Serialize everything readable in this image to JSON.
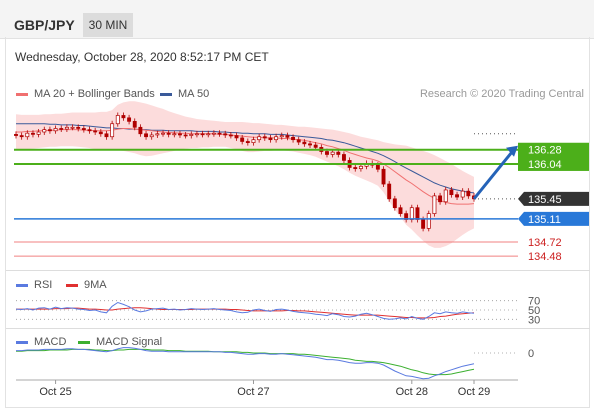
{
  "header": {
    "pair": "GBP/JPY",
    "timeframe": "30 MIN",
    "datetime": "Wednesday, October 28, 2020 8:52:17 PM CET"
  },
  "legend": {
    "ma20_label": "MA 20 + Bollinger Bands",
    "ma50_label": "MA 50",
    "credit": "Research © 2020 Trading Central",
    "rsi_label": "RSI",
    "rsi_ma_label": "9MA",
    "macd_label": "MACD",
    "macd_signal_label": "MACD Signal"
  },
  "colors": {
    "ma20": "#f07070",
    "ma50": "#3a5a9a",
    "bollinger_fill": "#fbd0d0",
    "resistance": "#4caf1a",
    "support": "#2878d8",
    "pivot_red": "#f08080",
    "price_badge": "#333333",
    "arrow": "#2563b8",
    "rsi": "#5a7ae0",
    "rsi_ma": "#e03030",
    "macd": "#5a7ae0",
    "macd_signal": "#3cb030"
  },
  "chart_data": [
    {
      "type": "line",
      "panel": "price",
      "x_ticks": [
        "Oct 25",
        "Oct 27",
        "Oct 28",
        "Oct 29"
      ],
      "last_price": 135.45,
      "levels": [
        {
          "value": 136.28,
          "label": "136.28",
          "kind": "resistance"
        },
        {
          "value": 136.04,
          "label": "136.04",
          "kind": "resistance"
        },
        {
          "value": 135.45,
          "label": "135.45",
          "kind": "last"
        },
        {
          "value": 135.11,
          "label": "135.11",
          "kind": "support"
        },
        {
          "value": 134.72,
          "label": "134.72",
          "kind": "pivot"
        },
        {
          "value": 134.48,
          "label": "134.48",
          "kind": "pivot"
        }
      ],
      "close": [
        136.52,
        136.5,
        136.56,
        136.54,
        136.58,
        136.62,
        136.6,
        136.64,
        136.63,
        136.66,
        136.66,
        136.64,
        136.62,
        136.6,
        136.58,
        136.55,
        136.5,
        136.72,
        136.86,
        136.82,
        136.76,
        136.66,
        136.55,
        136.5,
        136.53,
        136.55,
        136.56,
        136.54,
        136.55,
        136.53,
        136.52,
        136.54,
        136.55,
        136.54,
        136.55,
        136.56,
        136.55,
        136.53,
        136.52,
        136.48,
        136.42,
        136.4,
        136.45,
        136.5,
        136.48,
        136.45,
        136.5,
        136.52,
        136.49,
        136.45,
        136.41,
        136.38,
        136.36,
        136.32,
        136.25,
        136.2,
        136.24,
        136.2,
        136.1,
        135.98,
        135.96,
        136.0,
        136.05,
        136.02,
        135.95,
        135.7,
        135.45,
        135.3,
        135.2,
        135.1,
        135.3,
        135.1,
        134.95,
        135.2,
        135.5,
        135.4,
        135.6,
        135.52,
        135.48,
        135.58,
        135.5,
        135.45
      ],
      "ma20": [
        136.58,
        136.58,
        136.59,
        136.59,
        136.6,
        136.6,
        136.61,
        136.61,
        136.62,
        136.62,
        136.62,
        136.62,
        136.61,
        136.61,
        136.6,
        136.6,
        136.6,
        136.61,
        136.63,
        136.64,
        136.64,
        136.63,
        136.62,
        136.61,
        136.6,
        136.59,
        136.58,
        136.57,
        136.57,
        136.56,
        136.56,
        136.55,
        136.55,
        136.55,
        136.55,
        136.55,
        136.54,
        136.54,
        136.53,
        136.52,
        136.51,
        136.5,
        136.49,
        136.49,
        136.48,
        136.48,
        136.48,
        136.47,
        136.47,
        136.46,
        136.45,
        136.44,
        136.42,
        136.4,
        136.38,
        136.35,
        136.33,
        136.3,
        136.27,
        136.23,
        136.2,
        136.17,
        136.14,
        136.12,
        136.09,
        136.04,
        135.98,
        135.91,
        135.84,
        135.77,
        135.71,
        135.64,
        135.57,
        135.51,
        135.46,
        135.42,
        135.39,
        135.37,
        135.36,
        135.36,
        135.36,
        135.37
      ],
      "ma50": [
        136.72,
        136.72,
        136.72,
        136.72,
        136.72,
        136.72,
        136.71,
        136.71,
        136.7,
        136.7,
        136.7,
        136.69,
        136.69,
        136.68,
        136.67,
        136.66,
        136.65,
        136.65,
        136.64,
        136.64,
        136.63,
        136.63,
        136.62,
        136.62,
        136.61,
        136.61,
        136.61,
        136.6,
        136.6,
        136.6,
        136.6,
        136.6,
        136.59,
        136.59,
        136.59,
        136.59,
        136.58,
        136.58,
        136.57,
        136.57,
        136.56,
        136.56,
        136.55,
        136.55,
        136.55,
        136.54,
        136.54,
        136.54,
        136.53,
        136.52,
        136.51,
        136.5,
        136.49,
        136.48,
        136.47,
        136.45,
        136.44,
        136.42,
        136.4,
        136.37,
        136.34,
        136.31,
        136.28,
        136.25,
        136.22,
        136.18,
        136.13,
        136.08,
        136.02,
        135.97,
        135.92,
        135.87,
        135.82,
        135.77,
        135.72,
        135.68,
        135.65,
        135.62,
        135.6,
        135.58,
        135.56,
        135.55
      ],
      "bb_upper": [
        136.88,
        136.87,
        136.87,
        136.87,
        136.87,
        136.88,
        136.88,
        136.89,
        136.89,
        136.9,
        136.91,
        136.91,
        136.91,
        136.91,
        136.91,
        136.92,
        136.92,
        136.95,
        137.04,
        137.08,
        137.1,
        137.1,
        137.08,
        137.06,
        137.03,
        137.0,
        136.97,
        136.93,
        136.9,
        136.87,
        136.84,
        136.82,
        136.8,
        136.79,
        136.78,
        136.77,
        136.76,
        136.75,
        136.75,
        136.75,
        136.75,
        136.74,
        136.73,
        136.73,
        136.72,
        136.71,
        136.7,
        136.7,
        136.69,
        136.68,
        136.67,
        136.67,
        136.66,
        136.65,
        136.64,
        136.63,
        136.62,
        136.6,
        136.58,
        136.56,
        136.53,
        136.5,
        136.48,
        136.46,
        136.44,
        136.41,
        136.39,
        136.37,
        136.36,
        136.35,
        136.32,
        136.29,
        136.26,
        136.23,
        136.19,
        136.14,
        136.09,
        136.04,
        135.98,
        135.92,
        135.87,
        135.82
      ],
      "bb_lower": [
        136.28,
        136.28,
        136.29,
        136.3,
        136.31,
        136.32,
        136.33,
        136.33,
        136.34,
        136.34,
        136.34,
        136.33,
        136.32,
        136.31,
        136.29,
        136.28,
        136.27,
        136.27,
        136.27,
        136.26,
        136.24,
        136.22,
        136.19,
        136.17,
        136.18,
        136.2,
        136.22,
        136.24,
        136.26,
        136.28,
        136.3,
        136.31,
        136.31,
        136.32,
        136.32,
        136.33,
        136.33,
        136.33,
        136.31,
        136.29,
        136.26,
        136.24,
        136.24,
        136.25,
        136.26,
        136.26,
        136.27,
        136.27,
        136.26,
        136.25,
        136.23,
        136.21,
        136.19,
        136.16,
        136.12,
        136.08,
        136.04,
        136.0,
        135.95,
        135.89,
        135.84,
        135.8,
        135.76,
        135.72,
        135.67,
        135.56,
        135.41,
        135.27,
        135.14,
        135.01,
        134.93,
        134.83,
        134.74,
        134.66,
        134.62,
        134.62,
        134.65,
        134.7,
        134.77,
        134.84,
        134.9,
        134.95
      ],
      "forecast": {
        "from": 135.45,
        "to": 136.28
      }
    },
    {
      "type": "line",
      "panel": "rsi",
      "levels": [
        {
          "value": 70,
          "label": "70"
        },
        {
          "value": 50,
          "label": "50"
        },
        {
          "value": 30,
          "label": "30"
        }
      ],
      "series": [
        {
          "name": "RSI",
          "values": [
            52,
            51,
            53,
            50,
            54,
            55,
            52,
            56,
            53,
            55,
            54,
            52,
            51,
            49,
            50,
            46,
            44,
            58,
            66,
            62,
            57,
            50,
            46,
            48,
            52,
            53,
            54,
            51,
            52,
            50,
            51,
            53,
            52,
            51,
            52,
            53,
            51,
            50,
            49,
            46,
            44,
            45,
            50,
            52,
            49,
            47,
            51,
            52,
            50,
            47,
            45,
            44,
            43,
            41,
            40,
            38,
            42,
            40,
            36,
            35,
            37,
            41,
            43,
            40,
            36,
            32,
            30,
            31,
            33,
            31,
            36,
            32,
            30,
            36,
            44,
            42,
            46,
            44,
            43,
            46,
            44,
            43
          ]
        },
        {
          "name": "9MA",
          "values": [
            52,
            52,
            52,
            52,
            52,
            52,
            52,
            53,
            53,
            53,
            54,
            54,
            53,
            52,
            52,
            51,
            50,
            50,
            52,
            53,
            54,
            55,
            55,
            54,
            53,
            52,
            51,
            51,
            51,
            51,
            51,
            51,
            52,
            52,
            52,
            52,
            52,
            52,
            51,
            51,
            50,
            49,
            48,
            48,
            48,
            48,
            48,
            48,
            49,
            49,
            48,
            48,
            47,
            46,
            45,
            44,
            43,
            42,
            41,
            40,
            39,
            39,
            39,
            39,
            39,
            38,
            37,
            36,
            35,
            34,
            34,
            33,
            33,
            33,
            34,
            36,
            37,
            39,
            41,
            42,
            43,
            44
          ]
        }
      ]
    },
    {
      "type": "line",
      "panel": "macd",
      "levels": [
        {
          "value": 0,
          "label": "0"
        }
      ],
      "series": [
        {
          "name": "MACD",
          "values": [
            0.04,
            0.04,
            0.05,
            0.05,
            0.05,
            0.06,
            0.06,
            0.06,
            0.06,
            0.07,
            0.07,
            0.06,
            0.06,
            0.05,
            0.04,
            0.03,
            0.02,
            0.04,
            0.07,
            0.09,
            0.09,
            0.08,
            0.06,
            0.04,
            0.03,
            0.03,
            0.03,
            0.02,
            0.02,
            0.02,
            0.02,
            0.02,
            0.02,
            0.02,
            0.02,
            0.02,
            0.02,
            0.01,
            0.01,
            0.0,
            -0.01,
            -0.02,
            -0.02,
            -0.01,
            -0.01,
            -0.02,
            -0.02,
            -0.01,
            -0.02,
            -0.03,
            -0.04,
            -0.05,
            -0.06,
            -0.07,
            -0.09,
            -0.11,
            -0.11,
            -0.12,
            -0.14,
            -0.16,
            -0.17,
            -0.17,
            -0.16,
            -0.16,
            -0.17,
            -0.2,
            -0.25,
            -0.3,
            -0.34,
            -0.38,
            -0.39,
            -0.41,
            -0.43,
            -0.42,
            -0.38,
            -0.35,
            -0.31,
            -0.28,
            -0.25,
            -0.22,
            -0.2,
            -0.18
          ]
        },
        {
          "name": "MACD Signal",
          "values": [
            0.03,
            0.03,
            0.04,
            0.04,
            0.04,
            0.04,
            0.05,
            0.05,
            0.05,
            0.05,
            0.06,
            0.06,
            0.06,
            0.06,
            0.05,
            0.05,
            0.04,
            0.04,
            0.05,
            0.05,
            0.06,
            0.06,
            0.06,
            0.06,
            0.05,
            0.05,
            0.05,
            0.04,
            0.04,
            0.04,
            0.03,
            0.03,
            0.03,
            0.03,
            0.03,
            0.02,
            0.02,
            0.02,
            0.02,
            0.02,
            0.01,
            0.01,
            0.0,
            0.0,
            0.0,
            -0.01,
            -0.01,
            -0.01,
            -0.01,
            -0.01,
            -0.02,
            -0.02,
            -0.03,
            -0.04,
            -0.05,
            -0.06,
            -0.07,
            -0.08,
            -0.09,
            -0.1,
            -0.12,
            -0.13,
            -0.14,
            -0.14,
            -0.15,
            -0.16,
            -0.18,
            -0.2,
            -0.22,
            -0.25,
            -0.28,
            -0.3,
            -0.33,
            -0.35,
            -0.36,
            -0.36,
            -0.36,
            -0.35,
            -0.33,
            -0.31,
            -0.29,
            -0.27
          ]
        }
      ]
    }
  ]
}
